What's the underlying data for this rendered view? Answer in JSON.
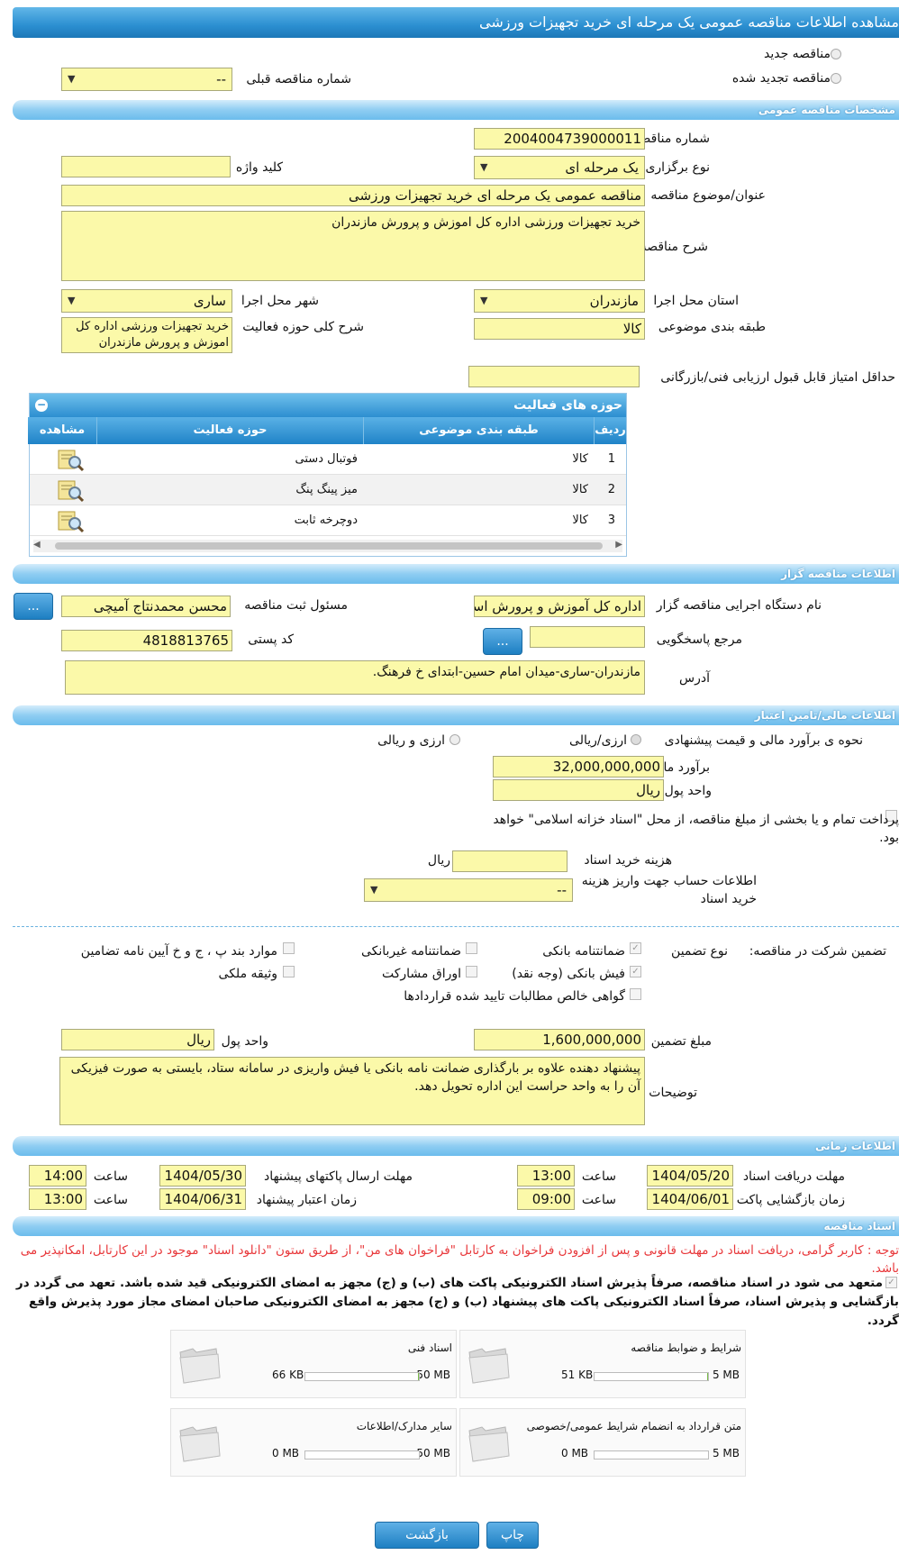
{
  "title": "مشاهده اطلاعات مناقصه عمومی یک مرحله ای خرید تجهیزات ورزشی",
  "top": {
    "new_label": "مناقصه جدید",
    "renew_label": "مناقصه تجدید شده",
    "prev_no_label": "شماره مناقصه قبلی",
    "prev_no_value": "--"
  },
  "general": {
    "section": "مشخصات مناقصه عمومی",
    "no_label": "شماره مناقصه",
    "no_value": "2004004739000011",
    "type_label": "نوع برگزاری",
    "type_value": "یک مرحله ای",
    "keyword_label": "کلید واژه",
    "keyword_value": "",
    "subject_label": "عنوان/موضوع مناقصه",
    "subject_value": "مناقصه عمومی یک مرحله ای خرید تجهیزات ورزشی",
    "desc_label": "شرح مناقصه",
    "desc_value": "خرید تجهیزات ورزشی اداره کل اموزش و پرورش مازندران",
    "province_label": "استان محل اجرا",
    "province_value": "مازندران",
    "city_label": "شهر محل اجرا",
    "city_value": "ساری",
    "category_label": "طبقه بندی موضوعی",
    "category_value": "کالا",
    "scope_label": "شرح کلی حوزه فعالیت",
    "scope_value": "خرید تجهیزات ورزشی اداره کل اموزش و پرورش مازندران",
    "minscore_label": "حداقل امتیاز قابل قبول ارزیابی فنی/بازرگانی",
    "minscore_value": ""
  },
  "activities": {
    "title": "حوزه های فعالیت",
    "headers": {
      "row": "ردیف",
      "category": "طبقه بندی موضوعی",
      "area": "حوزه فعالیت",
      "view": "مشاهده"
    },
    "rows": [
      {
        "n": "1",
        "category": "کالا",
        "area": "فوتبال دستی"
      },
      {
        "n": "2",
        "category": "کالا",
        "area": "میز پینگ پنگ"
      },
      {
        "n": "3",
        "category": "کالا",
        "area": "دوچرخه ثابت"
      }
    ]
  },
  "organizer": {
    "section": "اطلاعات مناقصه گزار",
    "org_label": "نام دستگاه اجرایی مناقصه گزار",
    "org_value": "اداره کل آموزش و پرورش استان",
    "resp_label": "مسئول ثبت مناقصه",
    "resp_value": "محسن محمدنتاج آمیچی",
    "ref_label": "مرجع پاسخگویی",
    "ref_value": "",
    "postal_label": "کد پستی",
    "postal_value": "4818813765",
    "addr_label": "آدرس",
    "addr_value": "مازندران-ساری-میدان امام حسین-ابتدای خ فرهنگ.",
    "dots": "..."
  },
  "finance": {
    "section": "اطلاعات مالی/تامین اعتبار",
    "method_label": "نحوه ی برآورد مالی و قیمت پیشنهادی",
    "opt1": "ارزی/ریالی",
    "opt2": "ارزی و ریالی",
    "estimate_label": "برآورد مالی",
    "estimate_value": "32,000,000,000",
    "currency_label": "واحد پول",
    "currency_value": "ریال",
    "islamic_label": "پرداخت تمام و یا بخشی از مبلغ مناقصه، از محل \"اسناد خزانه اسلامی\" خواهد بود.",
    "docfee_label": "هزینه خرید اسناد",
    "docfee_unit": "ریال",
    "docfee_value": "",
    "account_label": "اطلاعات حساب جهت واریز هزینه خرید اسناد",
    "account_value": "--"
  },
  "guarantee": {
    "label": "تضمین شرکت در مناقصه:",
    "type_label": "نوع تضمین",
    "bank": "ضمانتنامه بانکی",
    "nonbank": "ضمانتنامه غیربانکی",
    "cases": "موارد بند پ ، ج و خ آیین نامه تضامین",
    "fish": "فیش بانکی (وجه نقد)",
    "bonds": "اوراق مشارکت",
    "property": "وثیقه ملکی",
    "cert": "گواهی خالص مطالبات تایید شده قراردادها",
    "amount_label": "مبلغ تضمین",
    "amount_value": "1,600,000,000",
    "unit_label": "واحد پول",
    "unit_value": "ریال",
    "notes_label": "توضیحات",
    "notes_value": "پیشنهاد دهنده علاوه بر بارگذاری ضمانت نامه بانکی یا فیش واریزی در سامانه ستاد، بایستی به صورت فیزیکی آن را به واحد حراست این اداره تحویل دهد."
  },
  "timing": {
    "section": "اطلاعات زمانی",
    "recv_label": "مهلت دریافت اسناد",
    "recv_date": "1404/05/20",
    "recv_time": "13:00",
    "send_label": "مهلت ارسال پاکتهای پیشنهاد",
    "send_date": "1404/05/30",
    "send_time": "14:00",
    "open_label": "زمان بازگشایی پاکت ها",
    "open_date": "1404/06/01",
    "open_time": "09:00",
    "valid_label": "زمان اعتبار پیشنهاد",
    "valid_date": "1404/06/31",
    "valid_time": "13:00",
    "time_label": "ساعت"
  },
  "docs": {
    "section": "اسناد مناقصه",
    "notice": "توجه : کاربر گرامی، دریافت اسناد در مهلت قانونی و پس از افزودن فراخوان به کارتابل \"فراخوان های من\"، از طریق ستون \"دانلود اسناد\" موجود در این کارتابل، امکانپذیر می باشد.",
    "commit": "متعهد می شود در اسناد مناقصه، صرفاً پذیرش اسناد الکترونیکی پاکت های (ب) و (ج) مجهز به امضای الکترونیکی قید شده باشد. تعهد می گردد در بازگشایی و پذیرش اسناد، صرفاً اسناد الکترونیکی پاکت های پیشنهاد (ب) و (ج) مجهز به امضای الکترونیکی صاحبان امضای مجاز مورد پذیرش واقع گردد.",
    "items": [
      {
        "name": "شرایط و ضوابط مناقصه",
        "used": "51 KB",
        "max": "5 MB",
        "fill": 0.01
      },
      {
        "name": "اسناد فنی",
        "used": "66 KB",
        "max": "50 MB",
        "fill": 0.01
      },
      {
        "name": "متن قرارداد به انضمام شرایط عمومی/خصوصی",
        "used": "0 MB",
        "max": "5 MB",
        "fill": 0
      },
      {
        "name": "سایر مدارک/اطلاعات",
        "used": "0 MB",
        "max": "50 MB",
        "fill": 0
      }
    ]
  },
  "buttons": {
    "print": "چاپ",
    "back": "بازگشت"
  }
}
